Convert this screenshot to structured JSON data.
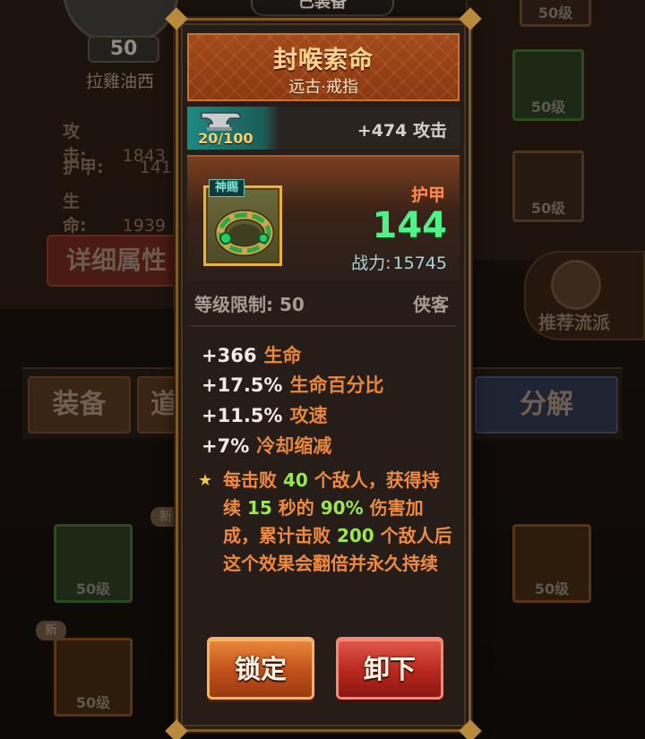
{
  "background": {
    "top_badge": "已装备",
    "player": {
      "level": "50",
      "name": "拉雞油西"
    },
    "stats": [
      {
        "label": "攻击:",
        "value": "1843"
      },
      {
        "label": "护甲:",
        "value": "141"
      },
      {
        "label": "生命:",
        "value": "1939"
      }
    ],
    "detail_button": "详细属性",
    "slot_level_label": "50级",
    "gift_label": "神赐",
    "recommend_label": "推荐流派",
    "new_tag": "新",
    "tabs": [
      "装备",
      "道",
      "分解"
    ]
  },
  "tooltip": {
    "item_name": "封喉索命",
    "item_type": "远古·戒指",
    "enhance_progress": "20/100",
    "enhance_bonus": "+474 攻击",
    "gift_tag": "神赐",
    "main_stat_label": "护甲",
    "main_stat_value": "144",
    "power_label": "战力:",
    "power_value": "15745",
    "level_requirement": "等级限制: 50",
    "class_name": "侠客",
    "stats": [
      {
        "value": "+366",
        "label": "生命"
      },
      {
        "value": "+17.5%",
        "label": "生命百分比"
      },
      {
        "value": "+11.5%",
        "label": "攻速"
      },
      {
        "value": "+7%",
        "label": "冷却缩减"
      }
    ],
    "skill": {
      "star": "★",
      "p1": "每击败 ",
      "n1": "40",
      "p2": " 个敌人，获得持续 ",
      "n2": "15",
      "p3": " 秒的 ",
      "n3": "90%",
      "p4": " 伤害加成，累计击败 ",
      "n4": "200",
      "p5": " 个敌人后这个效果会翻倍并永久持续"
    },
    "buttons": {
      "lock": "锁定",
      "unequip": "卸下"
    }
  },
  "icons": {
    "enhance": "anvil-icon",
    "item": "jade-ring-icon"
  },
  "colors": {
    "title_bg": "#a14a1c",
    "name_text": "#ffd38a",
    "armor_value": "#52f08a",
    "stat_label": "#e8863c",
    "skill_highlight": "#9ae84a",
    "lock_button": "#c2501a",
    "unequip_button": "#b8281e"
  }
}
